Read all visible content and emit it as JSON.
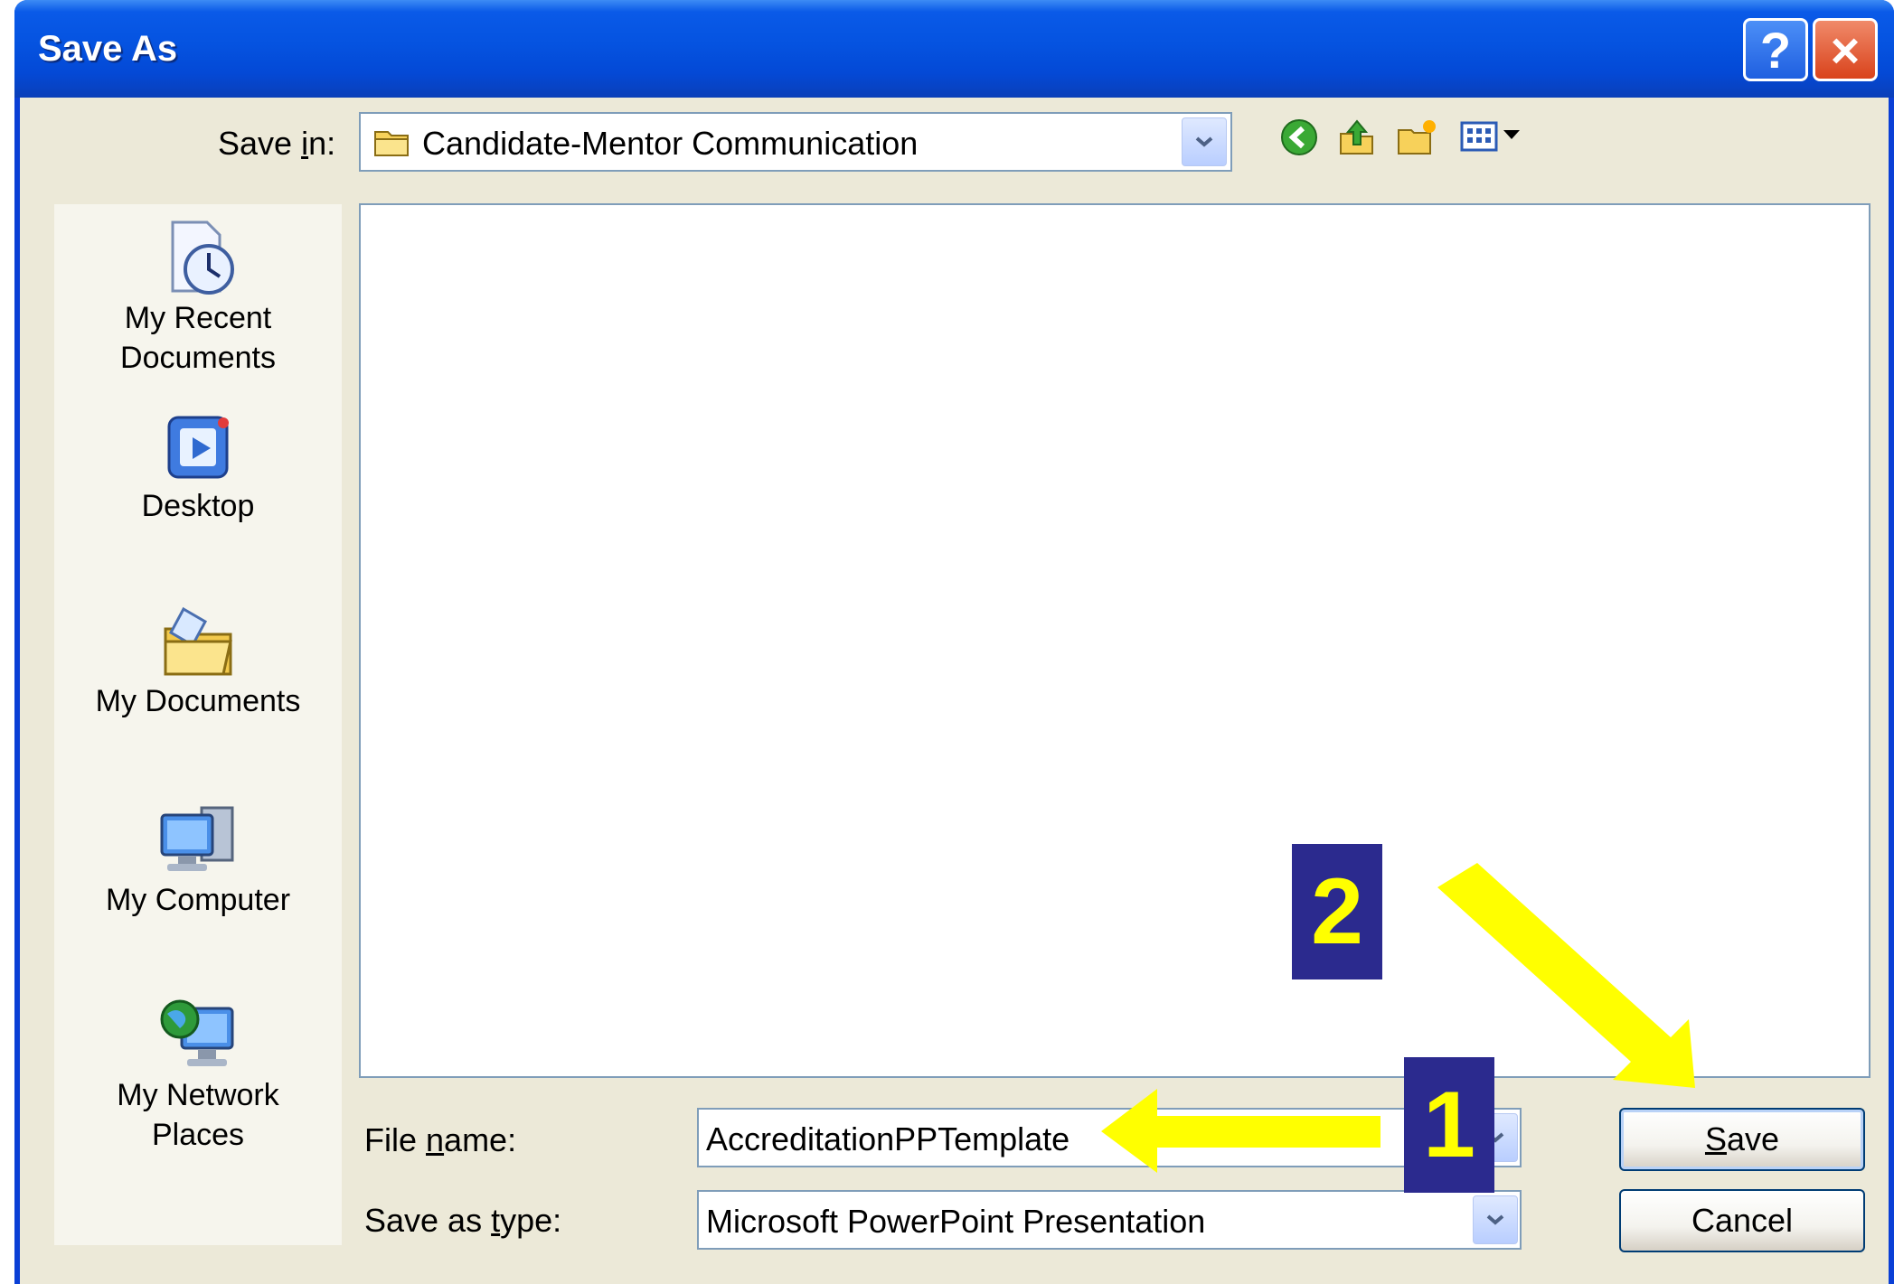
{
  "window": {
    "title": "Save As",
    "help_glyph": "?",
    "close_glyph": "×"
  },
  "save_in": {
    "label_pre": "Save ",
    "label_accel": "i",
    "label_post": "n:",
    "value": "Candidate-Mentor Communication",
    "icon": "folder-icon"
  },
  "toolbar": {
    "icons": [
      "back-icon",
      "up-folder-icon",
      "new-folder-icon",
      "views-menu-icon"
    ]
  },
  "places": [
    {
      "line1": "My Recent",
      "line2": "Documents",
      "icon": "recent-documents-icon"
    },
    {
      "line1": "Desktop",
      "line2": "",
      "icon": "desktop-icon"
    },
    {
      "line1": "My Documents",
      "line2": "",
      "icon": "my-documents-icon"
    },
    {
      "line1": "My Computer",
      "line2": "",
      "icon": "my-computer-icon"
    },
    {
      "line1": "My Network",
      "line2": "Places",
      "icon": "my-network-places-icon"
    }
  ],
  "file_name": {
    "label_pre": "File ",
    "label_accel": "n",
    "label_post": "ame:",
    "value": "AccreditationPPTemplate"
  },
  "save_as_type": {
    "label_pre": "Save as ",
    "label_accel": "t",
    "label_post": "ype:",
    "value": "Microsoft PowerPoint Presentation"
  },
  "buttons": {
    "save_accel": "S",
    "save_rest": "ave",
    "cancel": "Cancel"
  },
  "annotations": {
    "step1": "1",
    "step2": "2",
    "color": "#ffff00",
    "badge_color": "#2b2a8e"
  }
}
